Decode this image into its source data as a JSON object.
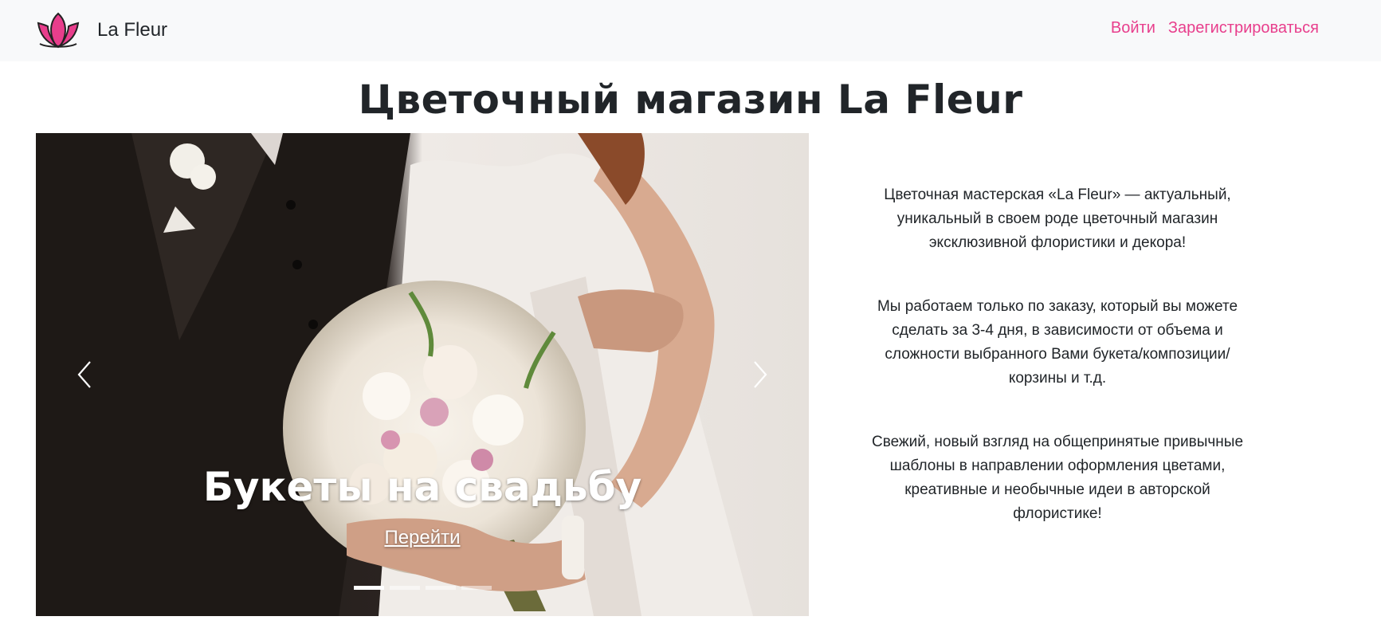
{
  "navbar": {
    "brand_name": "La Fleur",
    "brand_icon": "lotus-flower-icon",
    "brand_color": "#e83e8c",
    "links": [
      {
        "label": "Войти"
      },
      {
        "label": "Зарегистрироваться"
      }
    ],
    "link_color": "#e83e8c"
  },
  "page": {
    "title": "Цветочный магазин La Fleur"
  },
  "carousel": {
    "slide_title": "Букеты на свадьбу",
    "slide_link": "Перейти",
    "prev_icon": "chevron-left-icon",
    "next_icon": "chevron-right-icon",
    "slide_count": 4,
    "active_slide": 1
  },
  "about": {
    "paragraphs": [
      "Цветочная мастерская «La Fleur» — актуальный, уникальный в своем роде цветочный магазин эксклюзивной флористики и декора!",
      "Мы работаем только по заказу, который вы можете сделать за 3-4 дня, в зависимости от объема и сложности выбранного Вами букета/композиции/корзины и т.д.",
      "Свежий, новый взгляд на общепринятые привычные шаблоны в направлении оформления цветами, креативные и необычные идеи в авторской флористике!"
    ]
  }
}
